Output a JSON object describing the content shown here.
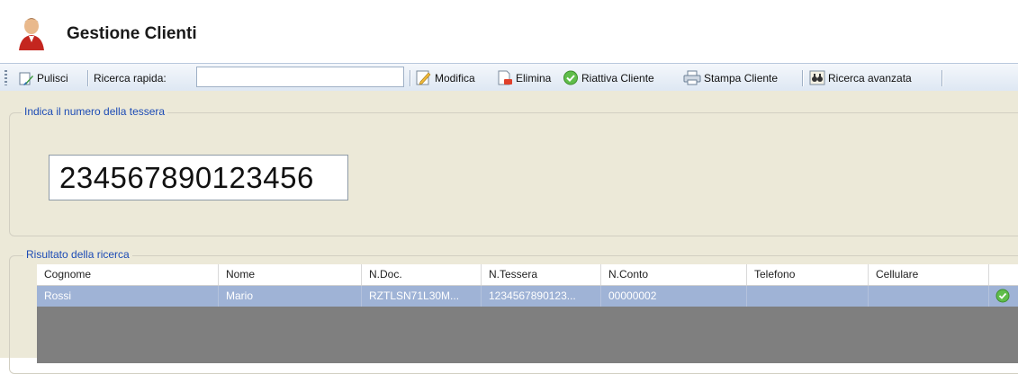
{
  "header": {
    "title": "Gestione Clienti",
    "icon": "user-red-icon"
  },
  "toolbar": {
    "pulisci": "Pulisci",
    "ricerca_rapida_label": "Ricerca rapida:",
    "ricerca_rapida_value": "",
    "modifica": "Modifica",
    "elimina": "Elimina",
    "riattiva": "Riattiva Cliente",
    "stampa": "Stampa Cliente",
    "ricerca_avanzata": "Ricerca avanzata"
  },
  "tessera_group": {
    "legend": "Indica il numero della tessera",
    "value": "234567890123456"
  },
  "results_group": {
    "legend": "Risultato della ricerca"
  },
  "grid": {
    "columns": [
      "Cognome",
      "Nome",
      "N.Doc.",
      "N.Tessera",
      "N.Conto",
      "Telefono",
      "Cellulare",
      ""
    ],
    "rows": [
      {
        "cognome": "Rossi",
        "nome": "Mario",
        "ndoc": "RZTLSN71L30M...",
        "ntessera": "1234567890123...",
        "nconto": "00000002",
        "telefono": "",
        "cellulare": "",
        "status_icon": "check-green-icon"
      }
    ]
  },
  "colors": {
    "toolbar_top": "#f4f7fb",
    "toolbar_bottom": "#dde7f3",
    "panel": "#ece9d8",
    "legend": "#1c4bb5",
    "row_selected": "#9fb3d6",
    "grid_empty": "#7f7f7f"
  }
}
